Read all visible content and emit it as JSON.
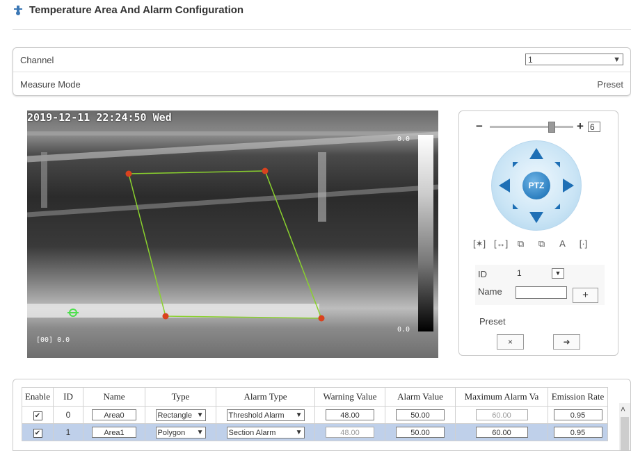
{
  "header": {
    "title": "Temperature Area And Alarm Configuration"
  },
  "config": {
    "channel_label": "Channel",
    "channel_value": "1",
    "measure_mode_label": "Measure Mode",
    "measure_mode_value": "Preset"
  },
  "video": {
    "timestamp": "2019-12-11 22:24:50 Wed",
    "scale_top": "0.0",
    "scale_bottom": "0.0",
    "bottom_left": "[00] 0.0",
    "polygon_color": "#8ad12e",
    "point_color": "#d9421e"
  },
  "ptz": {
    "zoom_minus": "−",
    "zoom_plus": "+",
    "zoom_value": "6",
    "center_label": "PTZ",
    "tool_icons": [
      "[✶]",
      "[↔]",
      "⧉",
      "⧉",
      "A",
      "[·]"
    ],
    "id_label": "ID",
    "id_value": "1",
    "name_label": "Name",
    "add_label": "+",
    "preset_label": "Preset",
    "delete_label": "×",
    "goto_label": "➜"
  },
  "table": {
    "columns": [
      "Enable",
      "ID",
      "Name",
      "Type",
      "Alarm Type",
      "Warning Value",
      "Alarm Value",
      "Maximum Alarm Va",
      "Emission Rate"
    ],
    "rows": [
      {
        "enabled": "✔",
        "id": "0",
        "name": "Area0",
        "type": "Rectangle",
        "alarm_type": "Threshold Alarm",
        "warning": "48.00",
        "alarm": "50.00",
        "max_alarm": "60.00",
        "emission": "0.95"
      },
      {
        "enabled": "✔",
        "id": "1",
        "name": "Area1",
        "type": "Polygon",
        "alarm_type": "Section Alarm",
        "warning": "48.00",
        "alarm": "50.00",
        "max_alarm": "60.00",
        "emission": "0.95"
      }
    ],
    "dropdown_arrow": "▼",
    "scroll_up": "˄"
  }
}
